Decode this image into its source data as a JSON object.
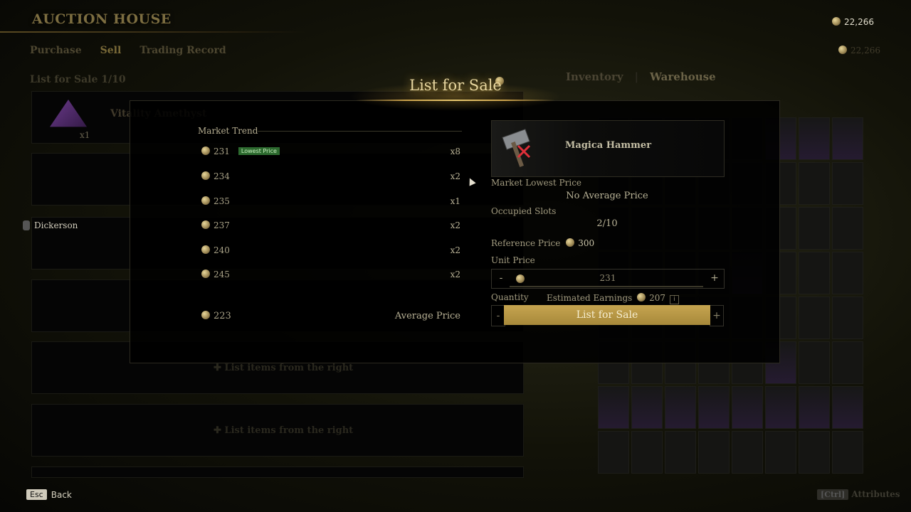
{
  "background": {
    "title": "AUCTION HOUSE",
    "tabs": [
      "Purchase",
      "Sell",
      "Trading Record"
    ],
    "active_tab": "Sell",
    "list_for_sale_count": "List for Sale 1/10",
    "listed_item": {
      "name": "Vitality Amethyst",
      "count": "x1"
    },
    "slot_placeholder": "List items from the right",
    "right_tabs": {
      "inventory": "Inventory",
      "warehouse": "Warehouse"
    },
    "gold_secondary": "22,266",
    "attributes_label": "Attributes",
    "attributes_key": "[Ctrl]"
  },
  "gold": "22,266",
  "player": {
    "name": "Dickerson"
  },
  "modal": {
    "title": "List for Sale",
    "market_trend": {
      "label": "Market Trend",
      "lowest_badge": "Lowest Price",
      "rows": [
        {
          "price": "231",
          "qty": "x8"
        },
        {
          "price": "234",
          "qty": "x2"
        },
        {
          "price": "235",
          "qty": "x1"
        },
        {
          "price": "237",
          "qty": "x2"
        },
        {
          "price": "240",
          "qty": "x2"
        },
        {
          "price": "245",
          "qty": "x2"
        }
      ],
      "average": {
        "price": "223",
        "label": "Average Price"
      }
    },
    "item": {
      "name": "Magica Hammer"
    },
    "market_lowest_price": {
      "label": "Market Lowest Price",
      "value": "No Average Price"
    },
    "occupied_slots": {
      "label": "Occupied Slots",
      "value": "2/10"
    },
    "reference_price": {
      "label": "Reference Price",
      "value": "300"
    },
    "unit_price": {
      "label": "Unit Price",
      "value": "231",
      "minus": "-",
      "plus": "+"
    },
    "quantity": {
      "label": "Quantity",
      "minus": "-",
      "plus": "+"
    },
    "estimated_earnings": {
      "label": "Estimated Earnings",
      "value": "207",
      "info": "i"
    },
    "list_button": "List for Sale"
  },
  "footer": {
    "esc_key": "Esc",
    "back_label": "Back"
  },
  "colors": {
    "accent_gold": "#c6a550",
    "lowest_badge": "#2d6a2f"
  }
}
